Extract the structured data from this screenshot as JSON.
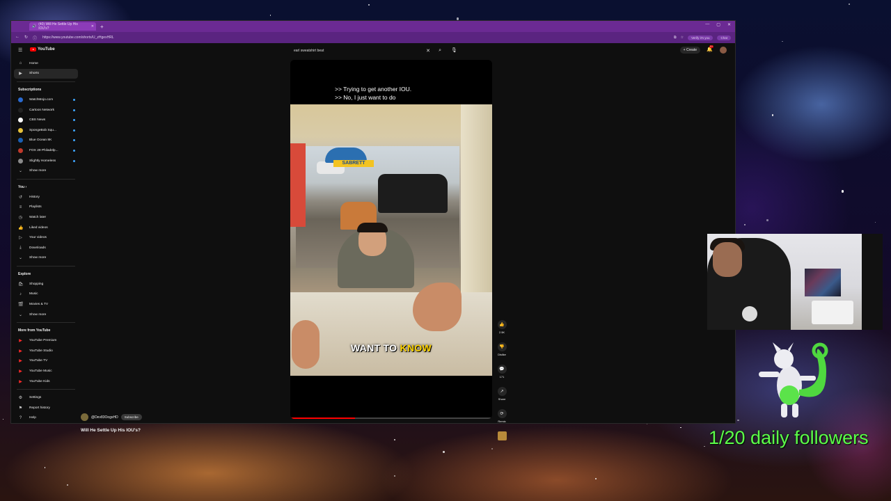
{
  "browser": {
    "tab_title": "(40) Will He Settle Up His IOU's?",
    "url": "https://www.youtube.com/shorts/U_zHgexHRL",
    "profile_pill": "Verify it's you",
    "chat_label": "Chat"
  },
  "youtube": {
    "logo_text": "YouTube",
    "search_value": "earl sweatshirt beat",
    "create_label": "Create",
    "notif_count": "9+",
    "sidebar": {
      "main": [
        {
          "label": "Home",
          "icon": "home-icon"
        },
        {
          "label": "Shorts",
          "icon": "shorts-icon"
        }
      ],
      "subscriptions_header": "Subscriptions",
      "subscriptions": [
        {
          "label": "WatchMojo.com",
          "color": "#2a6ad0"
        },
        {
          "label": "Cartoon Network",
          "color": "#222222"
        },
        {
          "label": "CBS News",
          "color": "#ffffff"
        },
        {
          "label": "SpongeBob Squ...",
          "color": "#e6c13a"
        },
        {
          "label": "Blue Ocean 8K",
          "color": "#1a5fb4"
        },
        {
          "label": "FOX 29 Philadelp...",
          "color": "#c0392b"
        },
        {
          "label": "Slightly Homeless",
          "color": "#8a8a8a"
        }
      ],
      "show_more": "Show more",
      "you_header": "You",
      "you": [
        {
          "label": "History",
          "icon": "history-icon"
        },
        {
          "label": "Playlists",
          "icon": "playlists-icon"
        },
        {
          "label": "Watch later",
          "icon": "clock-icon"
        },
        {
          "label": "Liked videos",
          "icon": "thumbs-up-icon"
        },
        {
          "label": "Your videos",
          "icon": "video-icon"
        },
        {
          "label": "Downloads",
          "icon": "download-icon"
        }
      ],
      "explore_header": "Explore",
      "explore": [
        {
          "label": "Shopping",
          "icon": "bag-icon"
        },
        {
          "label": "Music",
          "icon": "music-icon"
        },
        {
          "label": "Movies & TV",
          "icon": "film-icon"
        }
      ],
      "more_header": "More from YouTube",
      "more": [
        {
          "label": "YouTube Premium"
        },
        {
          "label": "YouTube Studio"
        },
        {
          "label": "YouTube TV"
        },
        {
          "label": "YouTube Music"
        },
        {
          "label": "YouTube Kids"
        }
      ],
      "footer": [
        {
          "label": "Settings",
          "icon": "gear-icon"
        },
        {
          "label": "Report history",
          "icon": "flag-icon"
        },
        {
          "label": "Help",
          "icon": "help-icon"
        }
      ]
    },
    "short": {
      "cc_line1": ">> Trying to get another IOU.",
      "cc_line2": ">> No, I just want to do",
      "sign_text": "SABRETT",
      "caption_main": "WANT TO ",
      "caption_highlight": "KNOW",
      "progress": 0.32,
      "likes": "2.5K",
      "dislike_label": "Dislike",
      "comments": "171",
      "share_label": "Share",
      "remix_label": "Remix",
      "channel": "@Dev83OogsHD",
      "subscribe_label": "Subscribe",
      "title": "Will He Settle Up His IOU's?"
    }
  },
  "overlay": {
    "followers_text": "1/20 daily followers",
    "followers_color": "#5dfc4a"
  }
}
